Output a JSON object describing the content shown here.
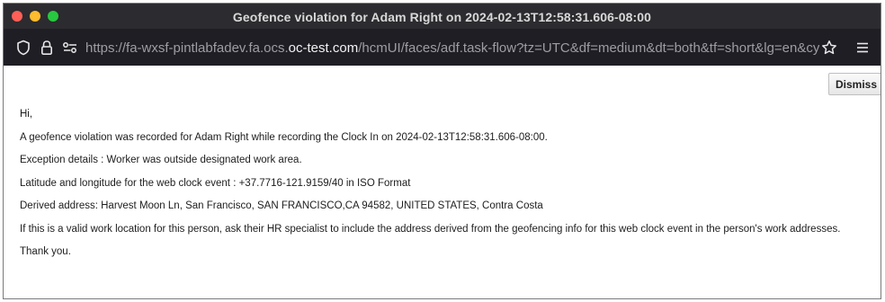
{
  "window": {
    "title": "Geofence violation for Adam Right on 2024-02-13T12:58:31.606-08:00"
  },
  "toolbar": {
    "url_prefix": "https://fa-wxsf-pintlabfadev.fa.ocs.",
    "url_domain": "oc-test.com",
    "url_path": "/hcmUI/faces/adf.task-flow?tz=UTC&df=medium&dt=both&tf=short&lg=en&cy=&bpmV"
  },
  "dismiss_label": "Dismiss",
  "message": {
    "greeting": "Hi,",
    "line1": "A geofence violation was recorded for  Adam Right while recording the Clock In on 2024-02-13T12:58:31.606-08:00.",
    "line2": "Exception details : Worker was outside designated work area.",
    "line3": "Latitude and longitude for the web clock event : +37.7716-121.9159/40 in ISO Format",
    "line4": "Derived address: Harvest Moon Ln, San Francisco, SAN FRANCISCO,CA 94582, UNITED STATES, Contra Costa",
    "line5": "If this is a valid work location for this person, ask their HR specialist to include the address derived from the geofencing info for this web clock event in the person's work addresses.",
    "closing": "Thank you."
  }
}
